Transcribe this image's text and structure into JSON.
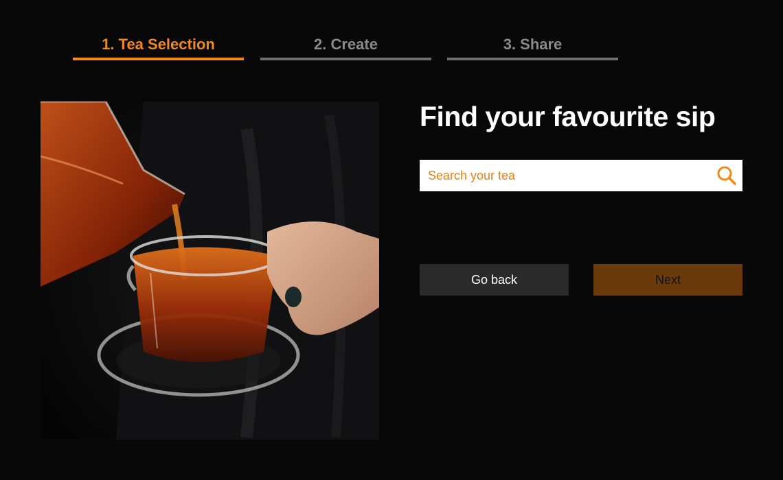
{
  "stepper": {
    "steps": [
      {
        "label": "1. Tea Selection",
        "active": true
      },
      {
        "label": "2. Create",
        "active": false
      },
      {
        "label": "3. Share",
        "active": false
      }
    ],
    "active_color": "#f08a1c",
    "inactive_color": "#6f6f6f"
  },
  "main": {
    "title": "Find your favourite sip",
    "search": {
      "value": "",
      "placeholder": "Search your tea",
      "icon": "search-icon"
    },
    "buttons": {
      "back_label": "Go back",
      "next_label": "Next"
    }
  },
  "photo": {
    "subject": "tea-pouring-image"
  },
  "colors": {
    "accent": "#f08a1c",
    "background": "#080808",
    "next_button": "#6b3a0c",
    "back_button": "#2a2a2a"
  }
}
